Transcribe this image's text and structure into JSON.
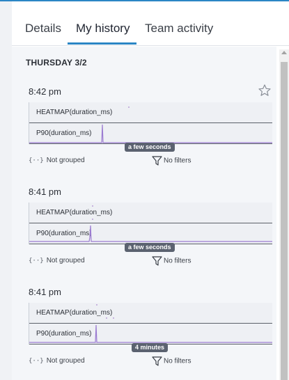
{
  "tabs": [
    {
      "label": "Details"
    },
    {
      "label": "My history"
    },
    {
      "label": "Team activity"
    }
  ],
  "active_tab": "My history",
  "day_header": "THURSDAY 3/2",
  "entries": [
    {
      "time": "8:42 pm",
      "viz_label_1": "HEATMAP(duration_ms)",
      "viz_label_2": "P90(duration_ms)",
      "relative_time": "a few seconds",
      "grouped": "Not grouped",
      "filters": "No filters"
    },
    {
      "time": "8:41 pm",
      "viz_label_1": "HEATMAP(duration_ms)",
      "viz_label_2": "P90(duration_ms)",
      "relative_time": "a few seconds",
      "grouped": "Not grouped",
      "filters": "No filters"
    },
    {
      "time": "8:41 pm",
      "viz_label_1": "HEATMAP(duration_ms)",
      "viz_label_2": "P90(duration_ms)",
      "relative_time": "4 minutes",
      "grouped": "Not grouped",
      "filters": "No filters"
    }
  ],
  "icons": {
    "star": "star-outline-icon",
    "grouped": "braces-icon",
    "filters": "funnel-icon"
  },
  "colors": {
    "accent": "#2b86c5",
    "spark_line": "#9b7bd1",
    "badge": "#5b6270"
  }
}
